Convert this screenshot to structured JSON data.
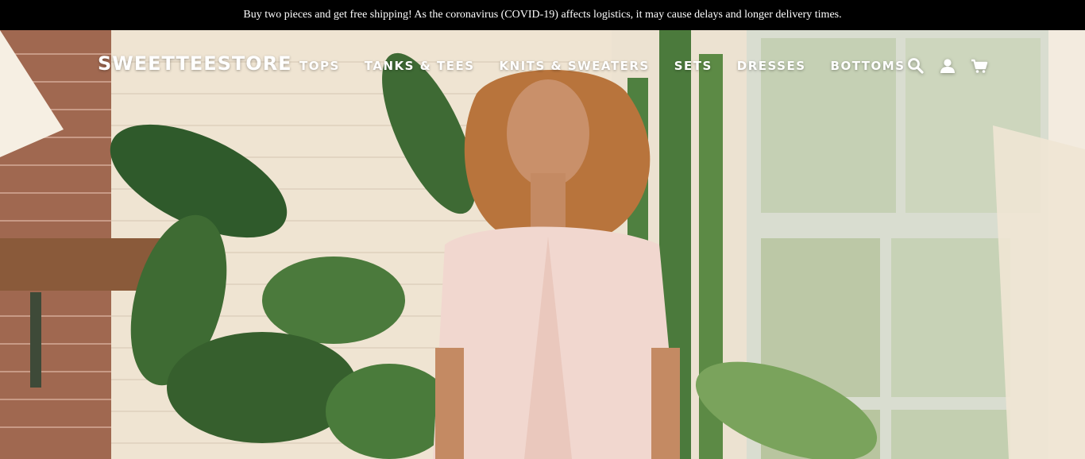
{
  "announcement": {
    "text": "Buy two pieces and get free shipping! As the coronavirus (COVID-19) affects logistics, it may cause delays and longer delivery times."
  },
  "header": {
    "logo": "SWEETTEESTORE",
    "nav": [
      {
        "label": "TOPS"
      },
      {
        "label": "TANKS & TEES"
      },
      {
        "label": "KNITS & SWEATERS"
      },
      {
        "label": "SETS"
      },
      {
        "label": "DRESSES"
      },
      {
        "label": "BOTTOMS"
      }
    ],
    "icons": [
      "search-icon",
      "account-icon",
      "cart-icon"
    ]
  },
  "hero": {
    "image": "woman-in-knit-cardigan-with-plants"
  },
  "colors": {
    "announcement_bg": "#000000",
    "text_light": "#ffffff"
  }
}
